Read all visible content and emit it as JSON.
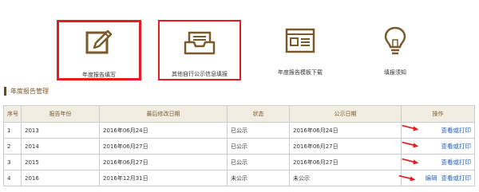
{
  "toolbar": {
    "tiles": [
      {
        "label": "年度报告填写",
        "icon": "pencil-edit-icon"
      },
      {
        "label": "其他自行公示信息填报",
        "icon": "inbox-tray-icon"
      },
      {
        "label": "年度报告模板下载",
        "icon": "browser-template-icon"
      },
      {
        "label": "填报须知",
        "icon": "lightbulb-icon"
      }
    ]
  },
  "section": {
    "title": "年度报告管理"
  },
  "table": {
    "headers": [
      "序号",
      "报告年份",
      "最后修改日期",
      "状态",
      "公示日期",
      "操作"
    ],
    "rows": [
      {
        "no": "1",
        "year": "2013",
        "modified": "2016年06月24日",
        "status": "已公示",
        "pub": "2016年06月24日",
        "actions": [
          "查看或打印"
        ]
      },
      {
        "no": "2",
        "year": "2014",
        "modified": "2016年06月27日",
        "status": "已公示",
        "pub": "2016年06月27日",
        "actions": [
          "查看或打印"
        ]
      },
      {
        "no": "3",
        "year": "2015",
        "modified": "2016年06月27日",
        "status": "已公示",
        "pub": "2016年06月27日",
        "actions": [
          "查看或打印"
        ]
      },
      {
        "no": "4",
        "year": "2016",
        "modified": "2016年12月31日",
        "status": "未公示",
        "pub": "未公示",
        "actions": [
          "编辑",
          "查看或打印"
        ]
      }
    ]
  },
  "colors": {
    "icon_brown": "#7a5a2a",
    "highlight_red": "#e51c23",
    "link_blue": "#2d64b3",
    "header_bg": "#f2ede3"
  }
}
